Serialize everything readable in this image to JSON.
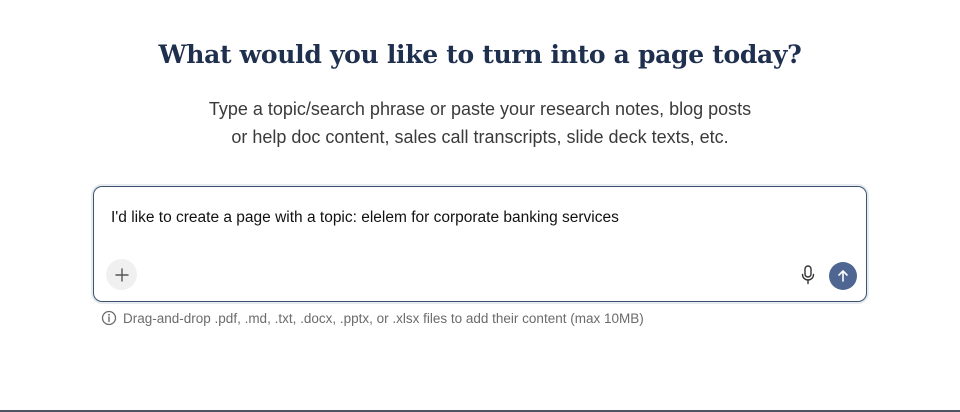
{
  "header": {
    "title": "What would you like to turn into a page today?",
    "subtitle_line1": "Type a topic/search phrase or paste your research notes, blog posts",
    "subtitle_line2": "or help doc content, sales call transcripts, slide deck texts, etc."
  },
  "composer": {
    "value": "I'd like to create a page with a topic: elelem for corporate banking services",
    "add_icon": "plus-icon",
    "mic_icon": "microphone-icon",
    "send_icon": "arrow-up-icon",
    "accent_color": "#4f6592",
    "border_color": "#3d5373"
  },
  "hint": {
    "icon": "info-icon",
    "text": "Drag-and-drop .pdf, .md, .txt, .docx, .pptx, or .xlsx files to add their content (max 10MB)"
  }
}
